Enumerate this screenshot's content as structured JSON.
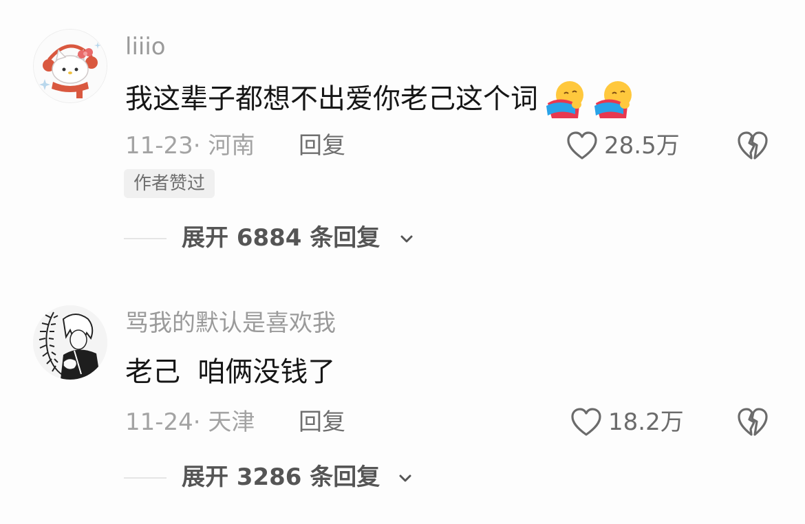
{
  "colors": {
    "background": "#fdfdfd",
    "username": "#9a9a9a",
    "text": "#161616",
    "meta": "#a3a3a3",
    "action": "#6e6e6e",
    "badge_bg": "#f0f0f0"
  },
  "comments": [
    {
      "avatar_icon": "hello-kitty-avatar",
      "username": "liiio",
      "text": "我这辈子都想不出爱你老己这个词",
      "emojis": [
        "hugging-face-emoji",
        "hugging-face-emoji"
      ],
      "date_location": "11-23· 河南",
      "reply_label": "回复",
      "like_icon": "heart-icon",
      "like_count": "28.5万",
      "dislike_icon": "broken-heart-icon",
      "badge": "作者赞过",
      "expand_label": "展开 6884 条回复",
      "expand_icon": "chevron-down-icon"
    },
    {
      "avatar_icon": "anime-character-avatar",
      "username": "骂我的默认是喜欢我",
      "text": "老己  咱俩没钱了",
      "date_location": "11-24· 天津",
      "reply_label": "回复",
      "like_icon": "heart-icon",
      "like_count": "18.2万",
      "dislike_icon": "broken-heart-icon",
      "expand_label": "展开 3286 条回复",
      "expand_icon": "chevron-down-icon"
    }
  ]
}
